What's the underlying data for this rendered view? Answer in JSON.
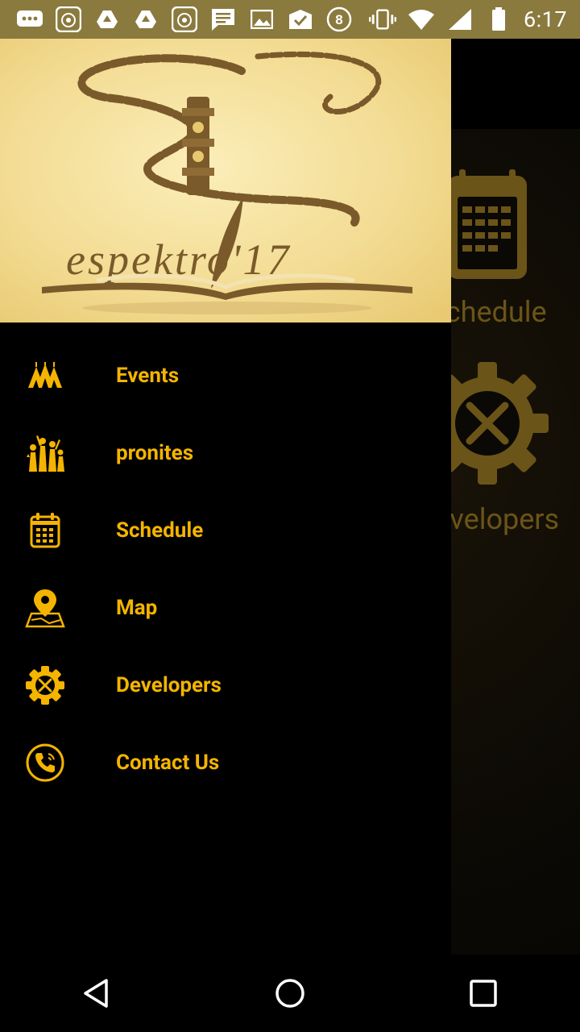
{
  "status_bar": {
    "time": "6:17",
    "left_icons": [
      "chat-bubble-icon",
      "app-badge-icon",
      "drive-icon",
      "drive-icon",
      "app-badge-icon",
      "message-icon",
      "image-icon",
      "mail-check-icon",
      "number-8-badge-icon"
    ],
    "right_icons": [
      "vibrate-icon",
      "wifi-icon",
      "cell-signal-icon",
      "battery-icon"
    ]
  },
  "drawer": {
    "header": {
      "logo_text": "espektro'17"
    },
    "items": [
      {
        "label": "Events",
        "icon": "circus-tent-icon"
      },
      {
        "label": "pronites",
        "icon": "crowd-icon"
      },
      {
        "label": "Schedule",
        "icon": "calendar-icon"
      },
      {
        "label": "Map",
        "icon": "map-pin-icon"
      },
      {
        "label": "Developers",
        "icon": "gear-tools-icon"
      },
      {
        "label": "Contact Us",
        "icon": "phone-icon"
      }
    ]
  },
  "main": {
    "tiles": [
      {
        "label": "Schedule",
        "icon": "calendar-icon"
      },
      {
        "label": "Developers",
        "icon": "gear-tools-icon"
      }
    ]
  },
  "nav_bar": {
    "buttons": [
      "back-icon",
      "home-icon",
      "recents-icon"
    ]
  },
  "colors": {
    "accent": "#f4b400",
    "status_bar": "#8a7a3e",
    "header_bg": "#f3dc94",
    "logo_brown": "#7a5a2a"
  }
}
